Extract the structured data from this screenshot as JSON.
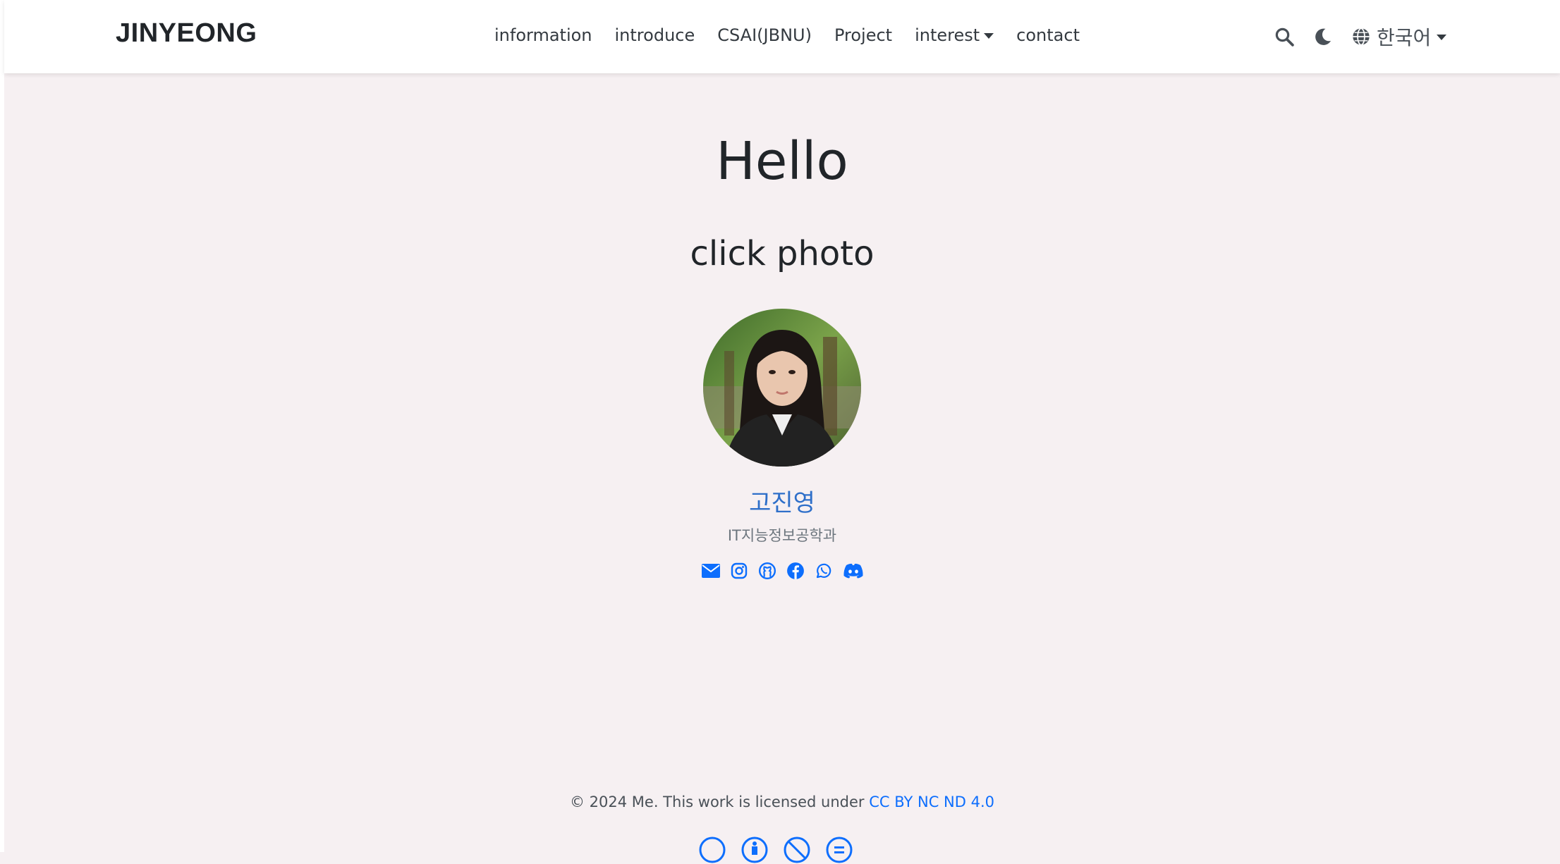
{
  "brand": "JINYEONG",
  "nav": {
    "items": [
      {
        "label": "information",
        "dropdown": false
      },
      {
        "label": "introduce",
        "dropdown": false
      },
      {
        "label": "CSAI(JBNU)",
        "dropdown": false
      },
      {
        "label": "Project",
        "dropdown": false
      },
      {
        "label": "interest",
        "dropdown": true
      },
      {
        "label": "contact",
        "dropdown": false
      }
    ],
    "search_icon": "search-icon",
    "theme_icon": "moon-icon",
    "language": {
      "icon": "globe-icon",
      "label": "한국어"
    }
  },
  "hero": {
    "title": "Hello",
    "subtitle": "click photo",
    "name": "고진영",
    "department": "IT지능정보공학과",
    "social_icons": [
      "envelope-icon",
      "instagram-icon",
      "github-icon",
      "facebook-icon",
      "whatsapp-icon",
      "discord-icon"
    ]
  },
  "footer": {
    "text": "© 2024 Me. This work is licensed under ",
    "license_link": "CC BY NC ND 4.0",
    "license_icons": [
      "cc-icon",
      "by-icon",
      "nc-icon",
      "nd-icon"
    ]
  },
  "colors": {
    "background": "#f6f0f2",
    "navbar": "#ffffff",
    "accent": "#0d6efd",
    "name_blue": "#2e6fc9"
  }
}
